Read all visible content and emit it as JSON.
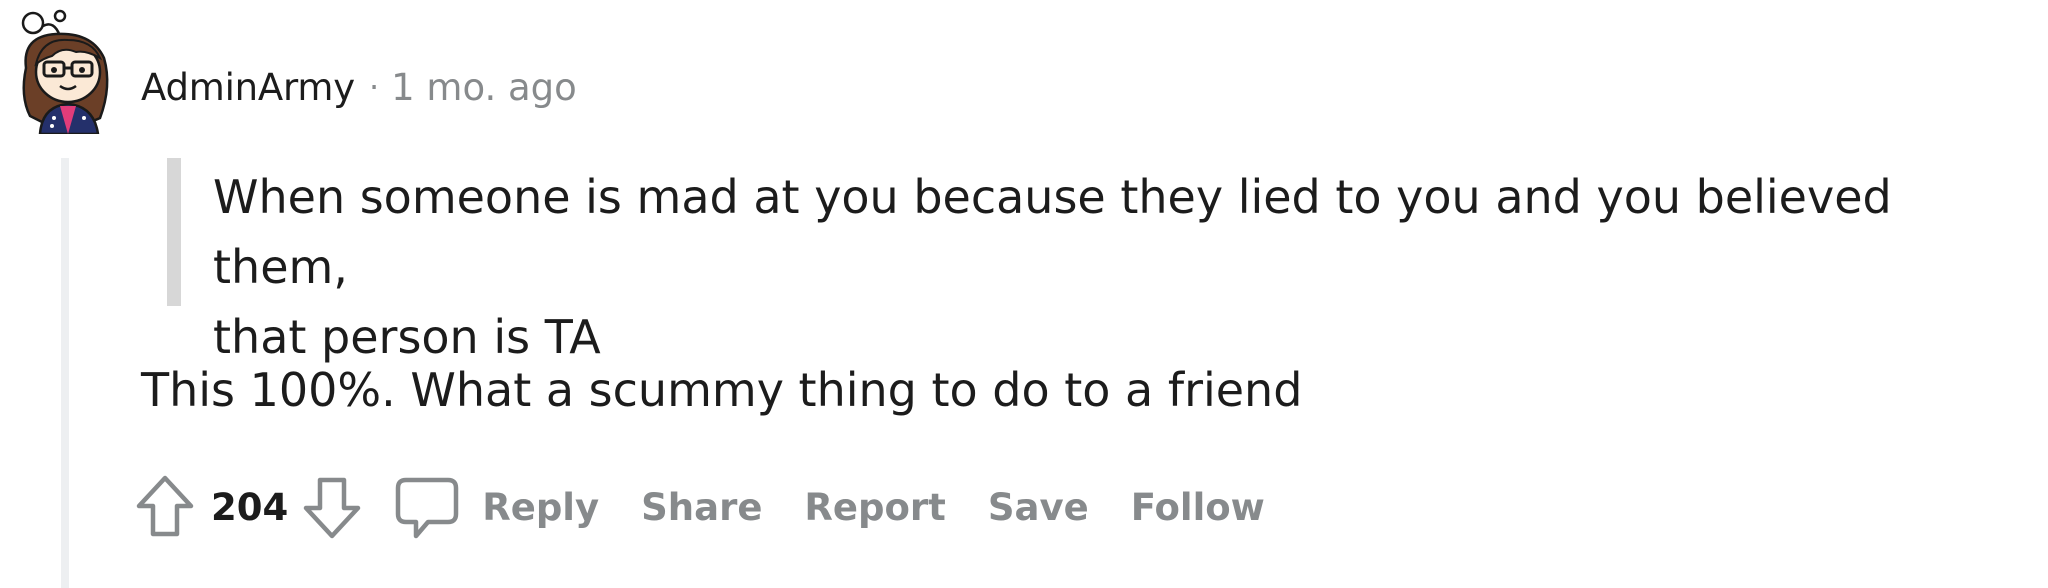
{
  "comment": {
    "author": "AdminArmy",
    "separator": "·",
    "timestamp": "1 mo. ago",
    "quote": "When someone is mad at you because they lied to you and you believed them,\nthat person is TA",
    "body": "This 100%. What a scummy thing to do to a friend",
    "score": "204",
    "actions": {
      "reply": "Reply",
      "share": "Share",
      "report": "Report",
      "save": "Save",
      "follow": "Follow"
    }
  },
  "icons": {
    "avatar": "snoo-avatar-icon",
    "upvote": "upvote-arrow-icon",
    "downvote": "downvote-arrow-icon",
    "reply": "comment-bubble-icon"
  },
  "colors": {
    "text": "#1c1c1c",
    "meta": "#878a8c",
    "quote_bar": "#d7d7d7",
    "thread_line": "#edeff1"
  }
}
